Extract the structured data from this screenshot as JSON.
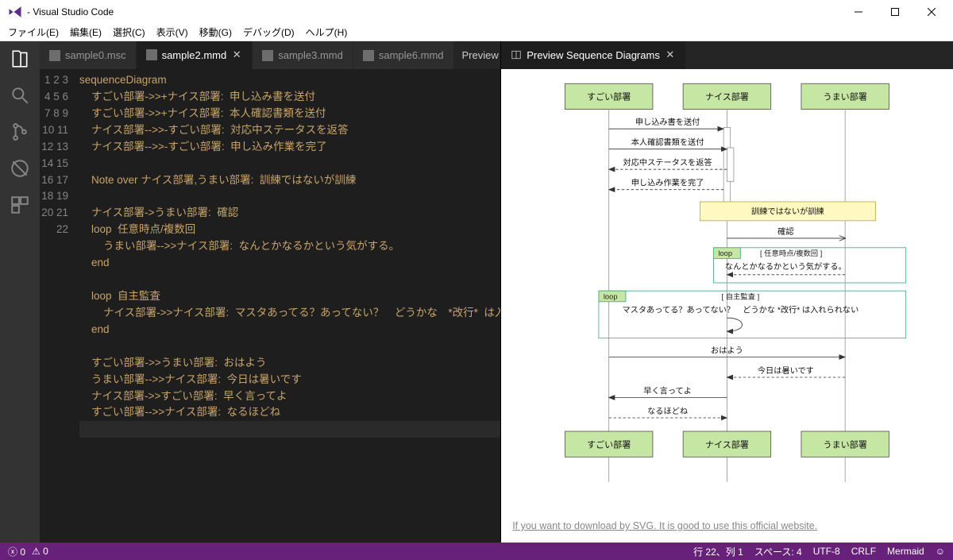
{
  "window": {
    "title": "- Visual Studio Code"
  },
  "menubar": [
    "ファイル(E)",
    "編集(E)",
    "選択(C)",
    "表示(V)",
    "移動(G)",
    "デバッグ(D)",
    "ヘルプ(H)"
  ],
  "editor_tabs": {
    "items": [
      {
        "label": "sample0.msc",
        "active": false
      },
      {
        "label": "sample2.mmd",
        "active": true
      },
      {
        "label": "sample3.mmd",
        "active": false
      },
      {
        "label": "sample6.mmd",
        "active": false
      }
    ],
    "action": "Preview"
  },
  "preview_tabs": {
    "title": "Preview Sequence Diagrams"
  },
  "code_lines": [
    "sequenceDiagram",
    "    すごい部署->>+ナイス部署:  申し込み書を送付",
    "    すごい部署->>+ナイス部署:  本人確認書類を送付",
    "    ナイス部署-->>-すごい部署:  対応中ステータスを返答",
    "    ナイス部署-->>-すごい部署:  申し込み作業を完了",
    "",
    "    Note over ナイス部署,うまい部署:  訓練ではないが訓練",
    "",
    "    ナイス部署->うまい部署:  確認",
    "    loop  任意時点/複数回",
    "        うまい部署-->>ナイス部署:  なんとかなるかという気がする。",
    "    end",
    "",
    "    loop  自主監査",
    "        ナイス部署->>ナイス部署:  マスタあってる？あってない？　どうかな　*改行*  は入",
    "    end",
    "",
    "    すごい部署->>うまい部署:  おはよう",
    "    うまい部署-->>ナイス部署:  今日は暑いです",
    "    ナイス部署->>すごい部署:  早く言ってよ",
    "    すごい部署-->>ナイス部署:  なるほどね",
    ""
  ],
  "diagram": {
    "actors": [
      "すごい部署",
      "ナイス部署",
      "うまい部署"
    ],
    "msgs": {
      "m1": "申し込み書を送付",
      "m2": "本人確認書類を送付",
      "m3": "対応中ステータスを返答",
      "m4": "申し込み作業を完了",
      "note": "訓練ではないが訓練",
      "m5": "確認",
      "loop1_title": "loop",
      "loop1_cond": "[ 任意時点/複数回 ]",
      "m6": "なんとかなるかという気がする。",
      "loop2_title": "loop",
      "loop2_cond": "[ 自主監査 ]",
      "m7": "マスタあってる？あってない？　どうかな *改行* は入れられない",
      "m8": "おはよう",
      "m9": "今日は暑いです",
      "m10": "早く言ってよ",
      "m11": "なるほどね"
    }
  },
  "preview_footer": "If you want to download by SVG. It is good to use this official website.",
  "statusbar": {
    "errors": "0",
    "warnings": "0",
    "cursor": "行 22、列 1",
    "spaces": "スペース: 4",
    "encoding": "UTF-8",
    "eol": "CRLF",
    "lang": "Mermaid"
  }
}
